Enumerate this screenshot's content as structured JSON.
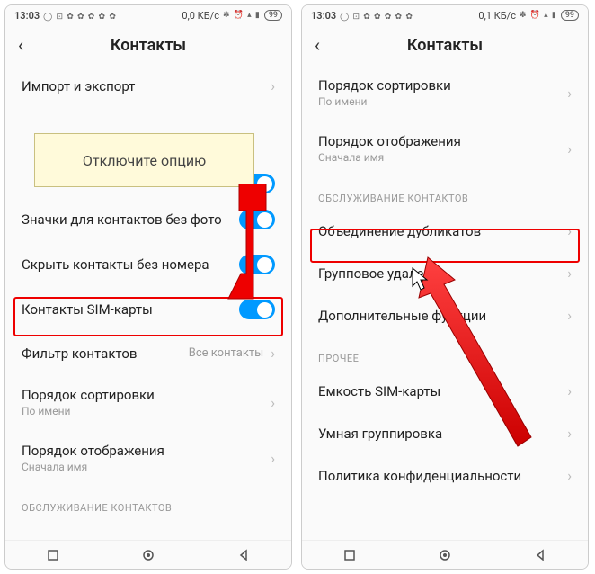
{
  "statusbar": {
    "time": "13:03",
    "net_left": "0,0 КБ/с",
    "net_right": "0,1 КБ/с",
    "battery": "99"
  },
  "header": {
    "title": "Контакты"
  },
  "callout": {
    "text": "Отключите опцию"
  },
  "left": {
    "import_export": "Импорт и экспорт",
    "icons_no_photo": "Значки для контактов без фото",
    "hide_no_number": "Скрыть контакты без номера",
    "sim_contacts": "Контакты SIM-карты",
    "filter": {
      "label": "Фильтр контактов",
      "value": "Все контакты"
    },
    "sort": {
      "label": "Порядок сортировки",
      "sub": "По имени"
    },
    "display": {
      "label": "Порядок отображения",
      "sub": "Сначала имя"
    },
    "section_service": "ОБСЛУЖИВАНИЕ КОНТАКТОВ"
  },
  "right": {
    "sort": {
      "label": "Порядок сортировки",
      "sub": "По имени"
    },
    "display": {
      "label": "Порядок отображения",
      "sub": "Сначала имя"
    },
    "section_service": "ОБСЛУЖИВАНИЕ КОНТАКТОВ",
    "merge_dupes": "Объединение дубликатов",
    "group_delete": "Групповое удаление",
    "additional": "Дополнительные функции",
    "section_other": "ПРОЧЕЕ",
    "sim_capacity": "Емкость SIM-карты",
    "smart_group": "Умная группировка",
    "privacy": "Политика конфиденциальности"
  }
}
